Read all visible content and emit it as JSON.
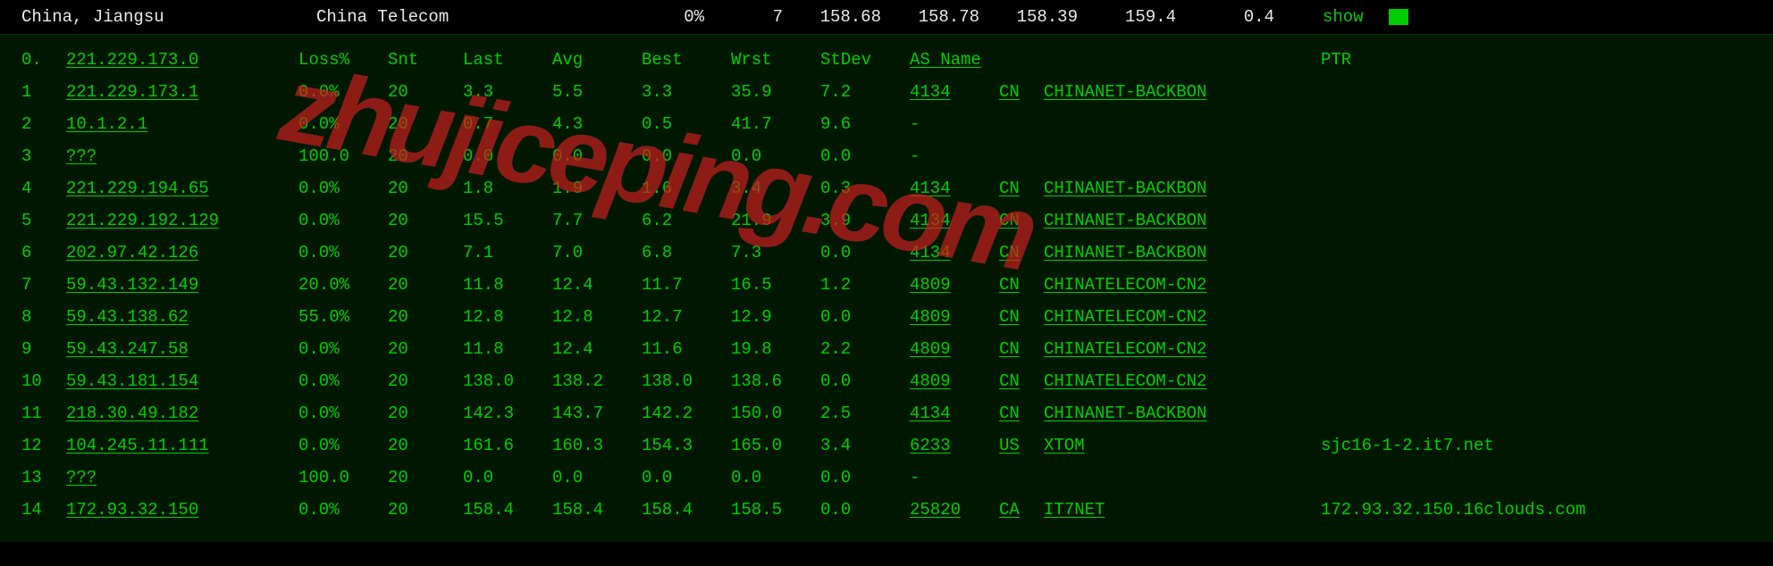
{
  "top": {
    "location": "China, Jiangsu",
    "isp": "China Telecom",
    "pct": "0%",
    "num": "7",
    "v1": "158.68",
    "v2": "158.78",
    "v3": "158.39",
    "v4": "159.4",
    "v5": "0.4",
    "show": "show"
  },
  "headers": {
    "hop": "0.",
    "ip": "221.229.173.0",
    "loss": "Loss%",
    "snt": "Snt",
    "last": "Last",
    "avg": "Avg",
    "best": "Best",
    "wrst": "Wrst",
    "stdev": "StDev",
    "asname": "AS Name",
    "ptr": "PTR"
  },
  "rows": [
    {
      "hop": "1",
      "ip": "221.229.173.1",
      "loss": "0.0%",
      "snt": "20",
      "last": "3.3",
      "avg": "5.5",
      "best": "3.3",
      "wrst": "35.9",
      "stdev": "7.2",
      "as": "4134",
      "cc": "CN",
      "name": "CHINANET-BACKBON",
      "ptr": ""
    },
    {
      "hop": "2",
      "ip": "10.1.2.1",
      "loss": "0.0%",
      "snt": "20",
      "last": "0.7",
      "avg": "4.3",
      "best": "0.5",
      "wrst": "41.7",
      "stdev": "9.6",
      "as": "-",
      "cc": "",
      "name": "",
      "ptr": ""
    },
    {
      "hop": "3",
      "ip": "???",
      "loss": "100.0",
      "snt": "20",
      "last": "0.0",
      "avg": "0.0",
      "best": "0.0",
      "wrst": "0.0",
      "stdev": "0.0",
      "as": "-",
      "cc": "",
      "name": "",
      "ptr": ""
    },
    {
      "hop": "4",
      "ip": "221.229.194.65",
      "loss": "0.0%",
      "snt": "20",
      "last": "1.8",
      "avg": "1.9",
      "best": "1.6",
      "wrst": "3.4",
      "stdev": "0.3",
      "as": "4134",
      "cc": "CN",
      "name": "CHINANET-BACKBON",
      "ptr": ""
    },
    {
      "hop": "5",
      "ip": "221.229.192.129",
      "loss": "0.0%",
      "snt": "20",
      "last": "15.5",
      "avg": "7.7",
      "best": "6.2",
      "wrst": "21.9",
      "stdev": "3.9",
      "as": "4134",
      "cc": "CN",
      "name": "CHINANET-BACKBON",
      "ptr": ""
    },
    {
      "hop": "6",
      "ip": "202.97.42.126",
      "loss": "0.0%",
      "snt": "20",
      "last": "7.1",
      "avg": "7.0",
      "best": "6.8",
      "wrst": "7.3",
      "stdev": "0.0",
      "as": "4134",
      "cc": "CN",
      "name": "CHINANET-BACKBON",
      "ptr": ""
    },
    {
      "hop": "7",
      "ip": "59.43.132.149",
      "loss": "20.0%",
      "snt": "20",
      "last": "11.8",
      "avg": "12.4",
      "best": "11.7",
      "wrst": "16.5",
      "stdev": "1.2",
      "as": "4809",
      "cc": "CN",
      "name": "CHINATELECOM-CN2",
      "ptr": ""
    },
    {
      "hop": "8",
      "ip": "59.43.138.62",
      "loss": "55.0%",
      "snt": "20",
      "last": "12.8",
      "avg": "12.8",
      "best": "12.7",
      "wrst": "12.9",
      "stdev": "0.0",
      "as": "4809",
      "cc": "CN",
      "name": "CHINATELECOM-CN2",
      "ptr": ""
    },
    {
      "hop": "9",
      "ip": "59.43.247.58",
      "loss": "0.0%",
      "snt": "20",
      "last": "11.8",
      "avg": "12.4",
      "best": "11.6",
      "wrst": "19.8",
      "stdev": "2.2",
      "as": "4809",
      "cc": "CN",
      "name": "CHINATELECOM-CN2",
      "ptr": ""
    },
    {
      "hop": "10",
      "ip": "59.43.181.154",
      "loss": "0.0%",
      "snt": "20",
      "last": "138.0",
      "avg": "138.2",
      "best": "138.0",
      "wrst": "138.6",
      "stdev": "0.0",
      "as": "4809",
      "cc": "CN",
      "name": "CHINATELECOM-CN2",
      "ptr": ""
    },
    {
      "hop": "11",
      "ip": "218.30.49.182",
      "loss": "0.0%",
      "snt": "20",
      "last": "142.3",
      "avg": "143.7",
      "best": "142.2",
      "wrst": "150.0",
      "stdev": "2.5",
      "as": "4134",
      "cc": "CN",
      "name": "CHINANET-BACKBON",
      "ptr": ""
    },
    {
      "hop": "12",
      "ip": "104.245.11.111",
      "loss": "0.0%",
      "snt": "20",
      "last": "161.6",
      "avg": "160.3",
      "best": "154.3",
      "wrst": "165.0",
      "stdev": "3.4",
      "as": "6233",
      "cc": "US",
      "name": "XTOM",
      "ptr": "sjc16-1-2.it7.net"
    },
    {
      "hop": "13",
      "ip": "???",
      "loss": "100.0",
      "snt": "20",
      "last": "0.0",
      "avg": "0.0",
      "best": "0.0",
      "wrst": "0.0",
      "stdev": "0.0",
      "as": "-",
      "cc": "",
      "name": "",
      "ptr": ""
    },
    {
      "hop": "14",
      "ip": "172.93.32.150",
      "loss": "0.0%",
      "snt": "20",
      "last": "158.4",
      "avg": "158.4",
      "best": "158.4",
      "wrst": "158.5",
      "stdev": "0.0",
      "as": "25820",
      "cc": "CA",
      "name": "IT7NET",
      "ptr": "172.93.32.150.16clouds.com"
    }
  ],
  "watermark": "zhujiceping.com"
}
